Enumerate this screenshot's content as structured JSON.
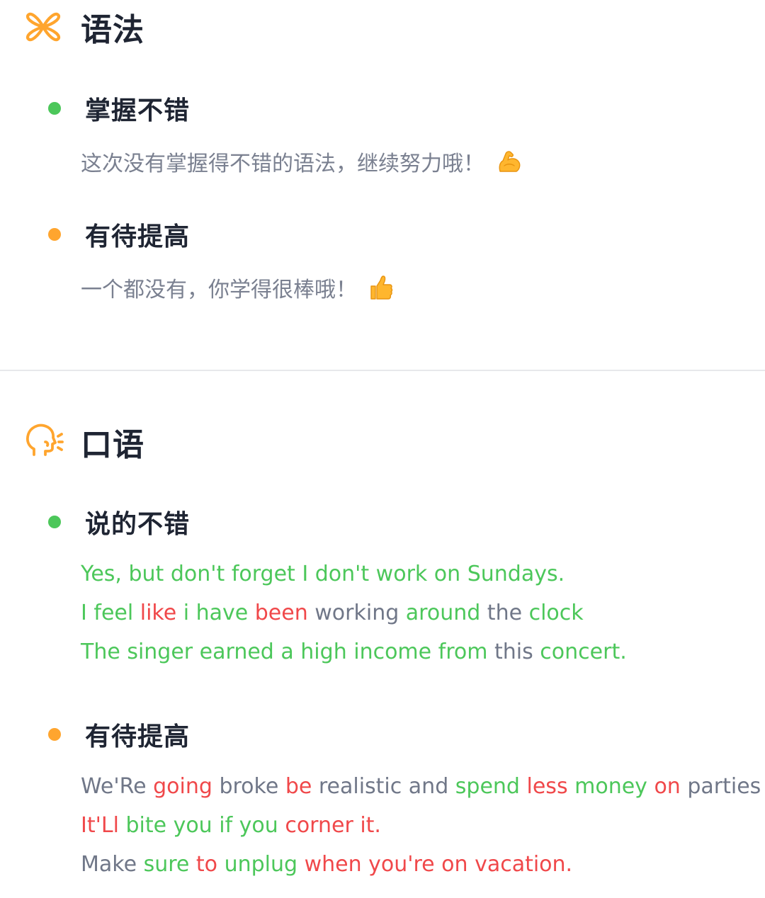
{
  "colors": {
    "accent": "#ffa52e",
    "good": "#4cc75a",
    "bad": "#f0484a",
    "neutral": "#707788",
    "title": "#1f2533",
    "message": "#7a8090",
    "divider": "#e7e8eb"
  },
  "grammar": {
    "icon": "grammar-knot-icon",
    "title": "语法",
    "good": {
      "title": "掌握不错",
      "message": "这次没有掌握得不错的语法，继续努力哦！",
      "emoji": "flexed-biceps-icon"
    },
    "improve": {
      "title": "有待提高",
      "message": "一个都没有，你学得很棒哦！",
      "emoji": "thumbs-up-icon"
    }
  },
  "speaking": {
    "icon": "speaking-head-icon",
    "title": "口语",
    "good": {
      "title": "说的不错",
      "sentences": [
        [
          {
            "t": "Yes, but don't forget I don't work on Sundays.",
            "s": "good"
          }
        ],
        [
          {
            "t": "I feel ",
            "s": "good"
          },
          {
            "t": "like",
            "s": "bad"
          },
          {
            "t": " i have ",
            "s": "good"
          },
          {
            "t": "been",
            "s": "bad"
          },
          {
            "t": " working ",
            "s": "neutral"
          },
          {
            "t": "around",
            "s": "good"
          },
          {
            "t": " the ",
            "s": "neutral"
          },
          {
            "t": "clock",
            "s": "good"
          }
        ],
        [
          {
            "t": "The singer earned a high income from ",
            "s": "good"
          },
          {
            "t": "this",
            "s": "neutral"
          },
          {
            "t": " concert.",
            "s": "good"
          }
        ]
      ]
    },
    "improve": {
      "title": "有待提高",
      "sentences": [
        [
          {
            "t": "We'Re ",
            "s": "neutral"
          },
          {
            "t": "going",
            "s": "bad"
          },
          {
            "t": " broke ",
            "s": "neutral"
          },
          {
            "t": "be",
            "s": "bad"
          },
          {
            "t": " realistic and ",
            "s": "neutral"
          },
          {
            "t": "spend",
            "s": "good"
          },
          {
            "t": " ",
            "s": "neutral"
          },
          {
            "t": "less",
            "s": "bad"
          },
          {
            "t": " money ",
            "s": "good"
          },
          {
            "t": "on",
            "s": "bad"
          },
          {
            "t": " parties",
            "s": "neutral"
          }
        ],
        [
          {
            "t": "It'Ll",
            "s": "bad"
          },
          {
            "t": " bite you if you ",
            "s": "good"
          },
          {
            "t": "corner it.",
            "s": "bad"
          }
        ],
        [
          {
            "t": "Make ",
            "s": "neutral"
          },
          {
            "t": "sure",
            "s": "good"
          },
          {
            "t": " to ",
            "s": "bad"
          },
          {
            "t": "unplug",
            "s": "good"
          },
          {
            "t": " when you're on vacation.",
            "s": "bad"
          }
        ]
      ]
    }
  }
}
